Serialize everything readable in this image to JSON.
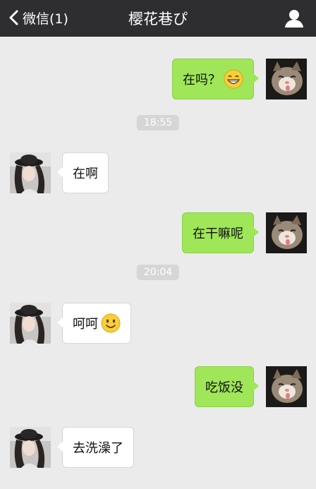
{
  "header": {
    "back_label": "微信(1)",
    "title": "樱花巷ぴ",
    "back_icon": "chevron-left-icon",
    "profile_icon": "person-icon"
  },
  "messages": [
    {
      "type": "message",
      "side": "right",
      "text": "在吗？",
      "emoji": "grin-emoji-icon"
    },
    {
      "type": "timestamp",
      "text": "18:55"
    },
    {
      "type": "message",
      "side": "left",
      "text": "在啊"
    },
    {
      "type": "message",
      "side": "right",
      "text": "在干嘛呢"
    },
    {
      "type": "timestamp",
      "text": "20:04"
    },
    {
      "type": "message",
      "side": "left",
      "text": "呵呵",
      "emoji": "smile-emoji-icon"
    },
    {
      "type": "message",
      "side": "right",
      "text": "吃饭没"
    },
    {
      "type": "message",
      "side": "left",
      "text": "去洗澡了"
    }
  ],
  "colors": {
    "topbar": "#2e2e31",
    "background": "#ebebeb",
    "sent_bubble": "#9fe658",
    "received_bubble": "#ffffff",
    "timestamp_bg": "#d6d6d6"
  }
}
